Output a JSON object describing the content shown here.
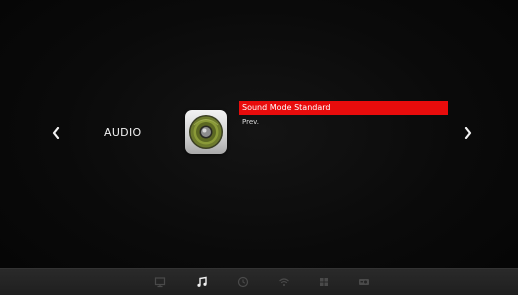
{
  "menu": {
    "section_title": "AUDIO",
    "items": [
      {
        "label": "Sound Mode Standard",
        "selected": true
      },
      {
        "label": "Prev.",
        "selected": false
      }
    ]
  },
  "navigation": {
    "left_arrow": "‹",
    "right_arrow": "›"
  },
  "bottom_bar": {
    "icons": [
      {
        "name": "picture-icon",
        "active": false
      },
      {
        "name": "music-note-icon",
        "active": true
      },
      {
        "name": "clock-icon",
        "active": false
      },
      {
        "name": "wifi-icon",
        "active": false
      },
      {
        "name": "grid-apps-icon",
        "active": false
      },
      {
        "name": "cd-player-icon",
        "active": false
      }
    ]
  },
  "colors": {
    "selection": "#e80c0c",
    "background": "#050505",
    "bar": "#252525",
    "icon_inactive": "#4a4a4a",
    "icon_active": "#f0f0f0"
  }
}
